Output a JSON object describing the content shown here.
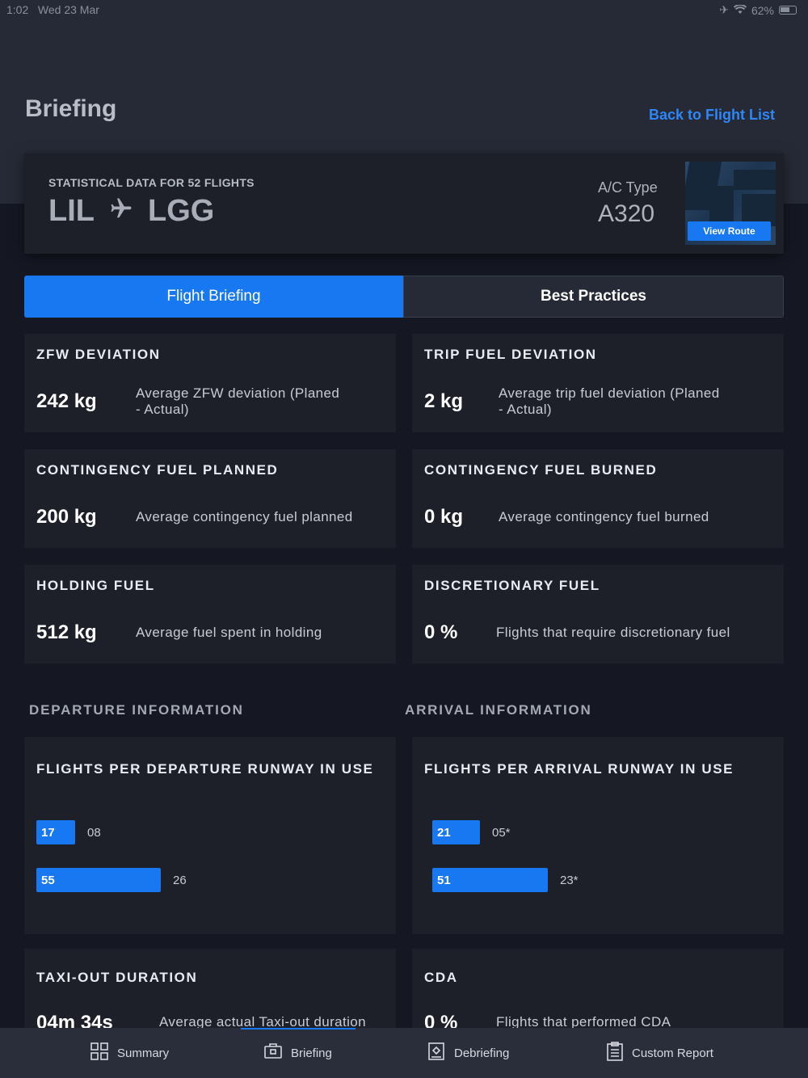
{
  "status_bar": {
    "time": "1:02",
    "date": "Wed 23 Mar",
    "battery": "62%"
  },
  "header": {
    "title": "Briefing",
    "back_link": "Back to Flight List"
  },
  "flight": {
    "stat_label": "STATISTICAL DATA FOR 52 FLIGHTS",
    "origin": "LIL",
    "destination": "LGG",
    "ac_type_label": "A/C Type",
    "ac_type": "A320",
    "view_route_label": "View Route"
  },
  "tabs": [
    {
      "label": "Flight Briefing",
      "active": true
    },
    {
      "label": "Best Practices",
      "active": false
    }
  ],
  "cards": {
    "zfw": {
      "title": "ZFW DEVIATION",
      "value": "242 kg",
      "desc_line1": "Average ZFW deviation (Planed",
      "desc_line2": "- Actual)"
    },
    "trip_fuel": {
      "title": "TRIP FUEL DEVIATION",
      "value": "2 kg",
      "desc_line1": "Average trip fuel deviation (Planed",
      "desc_line2": "- Actual)"
    },
    "contingency_planned": {
      "title": "CONTINGENCY FUEL PLANNED",
      "value": "200 kg",
      "desc": "Average contingency fuel planned"
    },
    "contingency_burned": {
      "title": "CONTINGENCY FUEL BURNED",
      "value": "0 kg",
      "desc": "Average contingency fuel burned"
    },
    "holding": {
      "title": "HOLDING FUEL",
      "value": "512 kg",
      "desc": "Average fuel spent in holding"
    },
    "discretionary": {
      "title": "DISCRETIONARY FUEL",
      "value": "0 %",
      "desc": "Flights that require discretionary fuel"
    },
    "taxi_out": {
      "title": "TAXI-OUT DURATION",
      "value": "04m 34s",
      "desc": "Average actual Taxi-out duration"
    },
    "cda": {
      "title": "CDA",
      "value": "0 %",
      "desc": "Flights that performed CDA"
    }
  },
  "sections": {
    "departure": "DEPARTURE INFORMATION",
    "arrival": "ARRIVAL INFORMATION"
  },
  "runways": {
    "departure": {
      "title": "FLIGHTS PER DEPARTURE RUNWAY IN USE",
      "bars": [
        {
          "count": "17",
          "runway": "08",
          "value": 17
        },
        {
          "count": "55",
          "runway": "26",
          "value": 55
        }
      ]
    },
    "arrival": {
      "title": "FLIGHTS PER ARRIVAL RUNWAY IN USE",
      "bars": [
        {
          "count": "21",
          "runway": "05*",
          "value": 21
        },
        {
          "count": "51",
          "runway": "23*",
          "value": 51
        }
      ]
    }
  },
  "bottom_nav": [
    {
      "label": "Summary",
      "icon": "grid-icon"
    },
    {
      "label": "Briefing",
      "icon": "briefcase-icon"
    },
    {
      "label": "Debriefing",
      "icon": "document-icon"
    },
    {
      "label": "Custom Report",
      "icon": "clipboard-icon"
    }
  ],
  "colors": {
    "accent": "#1778f2",
    "background": "#151823",
    "card": "#1d2029"
  }
}
